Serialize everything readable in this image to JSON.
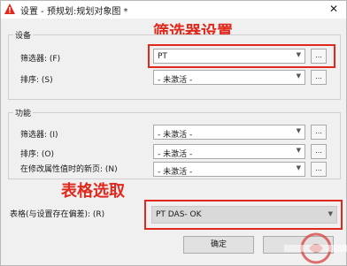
{
  "window": {
    "title": "设置 - 预规划:规划对象图 *",
    "close_glyph": "✕"
  },
  "annotations": {
    "filter_setup": "筛选器设置",
    "table_select": "表格选取"
  },
  "device_group": {
    "title": "设备",
    "filter_label": "筛选器: (F)",
    "filter_value": "PT",
    "sort_label": "排序: (S)",
    "sort_value": "- 未激活 -"
  },
  "function_group": {
    "title": "功能",
    "filter_label": "筛选器: (I)",
    "filter_value": "- 未激活 -",
    "sort_label": "排序: (O)",
    "sort_value": "- 未激活 -",
    "newpage_label": "在修改属性值时的新页: (N)",
    "newpage_value": "- 未激活 -"
  },
  "table": {
    "label": "表格(与设置存在偏差): (R)",
    "value": "PT DAS- OK"
  },
  "buttons": {
    "ok_label": "确定",
    "browse_label": "..."
  },
  "icons": {
    "arrow": "▼"
  },
  "colors": {
    "annotation_red": "#e0281c",
    "window_bg": "#f0f0f0"
  }
}
